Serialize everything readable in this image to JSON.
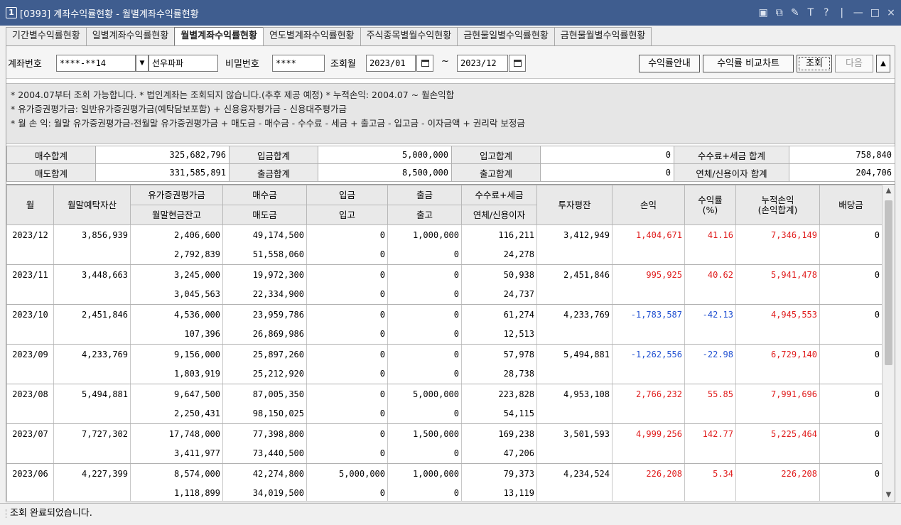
{
  "window": {
    "num": "1",
    "title": "[0393] 계좌수익률현황 - 월별계좌수익률현황",
    "controls": [
      "▣",
      "⧉",
      "✎",
      "T",
      "?",
      "|",
      "—",
      "□",
      "×"
    ]
  },
  "tabs": [
    {
      "label": "기간별수익률현황",
      "active": false
    },
    {
      "label": "일별계좌수익률현황",
      "active": false
    },
    {
      "label": "월별계좌수익률현황",
      "active": true
    },
    {
      "label": "연도별계좌수익률현황",
      "active": false
    },
    {
      "label": "주식종목별월수익현황",
      "active": false
    },
    {
      "label": "금현물일별수익률현황",
      "active": false
    },
    {
      "label": "금현물월별수익률현황",
      "active": false
    }
  ],
  "query": {
    "account_label": "계좌번호",
    "account_value": "****-**14",
    "dropdown_glyph": "▼",
    "account_name": "선우파파",
    "password_label": "비밀번호",
    "password_value": "****",
    "period_label": "조회월",
    "from": "2023/01",
    "tilde": "~",
    "to": "2023/12",
    "btn_guide": "수익률안내",
    "btn_chart": "수익률 비교차트",
    "btn_search": "조회",
    "btn_next": "다음",
    "btn_up": "▲"
  },
  "notes": [
    "* 2004.07부터 조회 가능합니다.   * 법인계좌는 조회되지 않습니다.(추후 제공 예정)   * 누적손익: 2004.07 ~ 월손익합",
    "* 유가증권평가금: 일반유가증권평가금(예탁담보포함) + 신용융자평가금 - 신용대주평가금",
    "* 월 손 익: 월말 유가증권평가금-전월말 유가증권평가금 + 매도금 - 매수금 - 수수료 - 세금 + 출고금 - 입고금 - 이자금액 + 권리락 보정금"
  ],
  "summary": {
    "row1": [
      {
        "label": "매수합계",
        "value": "325,682,796"
      },
      {
        "label": "입금합계",
        "value": "5,000,000"
      },
      {
        "label": "입고합계",
        "value": "0"
      },
      {
        "label": "수수료+세금 합계",
        "value": "758,840"
      }
    ],
    "row2": [
      {
        "label": "매도합계",
        "value": "331,585,891"
      },
      {
        "label": "출금합계",
        "value": "8,500,000"
      },
      {
        "label": "출고합계",
        "value": "0"
      },
      {
        "label": "연체/신용이자 합계",
        "value": "204,706"
      }
    ]
  },
  "headers": {
    "month": "월",
    "deposit": "월말예탁자산",
    "sec_eval": "유가증권평가금",
    "cash": "월말현금잔고",
    "buy": "매수금",
    "sell": "매도금",
    "in_money": "입금",
    "in_stock": "입고",
    "out_money": "출금",
    "out_stock": "출고",
    "fee": "수수료+세금",
    "interest": "연체/신용이자",
    "avg_inv": "투자평잔",
    "pnl": "손익",
    "rate_1": "수익률",
    "rate_2": "(%)",
    "cum_1": "누적손익",
    "cum_2": "(손익합계)",
    "dividend": "배당금"
  },
  "rows": [
    {
      "month": "2023/12",
      "deposit": "3,856,939",
      "sec_eval": "2,406,600",
      "cash": "2,792,839",
      "buy": "49,174,500",
      "sell": "51,558,060",
      "in_money": "0",
      "in_stock": "0",
      "out_money": "1,000,000",
      "out_stock": "0",
      "fee": "116,211",
      "interest": "24,278",
      "avg_inv": "3,412,949",
      "pnl": "1,404,671",
      "rate": "41.16",
      "cum": "7,346,149",
      "dividend": "0",
      "sign": "pos"
    },
    {
      "month": "2023/11",
      "deposit": "3,448,663",
      "sec_eval": "3,245,000",
      "cash": "3,045,563",
      "buy": "19,972,300",
      "sell": "22,334,900",
      "in_money": "0",
      "in_stock": "0",
      "out_money": "0",
      "out_stock": "0",
      "fee": "50,938",
      "interest": "24,737",
      "avg_inv": "2,451,846",
      "pnl": "995,925",
      "rate": "40.62",
      "cum": "5,941,478",
      "dividend": "0",
      "sign": "pos"
    },
    {
      "month": "2023/10",
      "deposit": "2,451,846",
      "sec_eval": "4,536,000",
      "cash": "107,396",
      "buy": "23,959,786",
      "sell": "26,869,986",
      "in_money": "0",
      "in_stock": "0",
      "out_money": "0",
      "out_stock": "0",
      "fee": "61,274",
      "interest": "12,513",
      "avg_inv": "4,233,769",
      "pnl": "-1,783,587",
      "rate": "-42.13",
      "cum": "4,945,553",
      "dividend": "0",
      "sign": "neg"
    },
    {
      "month": "2023/09",
      "deposit": "4,233,769",
      "sec_eval": "9,156,000",
      "cash": "1,803,919",
      "buy": "25,897,260",
      "sell": "25,212,920",
      "in_money": "0",
      "in_stock": "0",
      "out_money": "0",
      "out_stock": "0",
      "fee": "57,978",
      "interest": "28,738",
      "avg_inv": "5,494,881",
      "pnl": "-1,262,556",
      "rate": "-22.98",
      "cum": "6,729,140",
      "dividend": "0",
      "sign": "neg"
    },
    {
      "month": "2023/08",
      "deposit": "5,494,881",
      "sec_eval": "9,647,500",
      "cash": "2,250,431",
      "buy": "87,005,350",
      "sell": "98,150,025",
      "in_money": "0",
      "in_stock": "0",
      "out_money": "5,000,000",
      "out_stock": "0",
      "fee": "223,828",
      "interest": "54,115",
      "avg_inv": "4,953,108",
      "pnl": "2,766,232",
      "rate": "55.85",
      "cum": "7,991,696",
      "dividend": "0",
      "sign": "pos"
    },
    {
      "month": "2023/07",
      "deposit": "7,727,302",
      "sec_eval": "17,748,000",
      "cash": "3,411,977",
      "buy": "77,398,800",
      "sell": "73,440,500",
      "in_money": "0",
      "in_stock": "0",
      "out_money": "1,500,000",
      "out_stock": "0",
      "fee": "169,238",
      "interest": "47,206",
      "avg_inv": "3,501,593",
      "pnl": "4,999,256",
      "rate": "142.77",
      "cum": "5,225,464",
      "dividend": "0",
      "sign": "pos"
    },
    {
      "month": "2023/06",
      "deposit": "4,227,399",
      "sec_eval": "8,574,000",
      "cash": "1,118,899",
      "buy": "42,274,800",
      "sell": "34,019,500",
      "in_money": "5,000,000",
      "in_stock": "0",
      "out_money": "1,000,000",
      "out_stock": "0",
      "fee": "79,373",
      "interest": "13,119",
      "avg_inv": "4,234,524",
      "pnl": "226,208",
      "rate": "5.34",
      "cum": "226,208",
      "dividend": "0",
      "sign": "pos"
    }
  ],
  "colors": {
    "positive": "#e01c1c",
    "negative": "#1f4fd1",
    "titlebar": "#3f5d8f"
  },
  "status": "조회 완료되었습니다."
}
